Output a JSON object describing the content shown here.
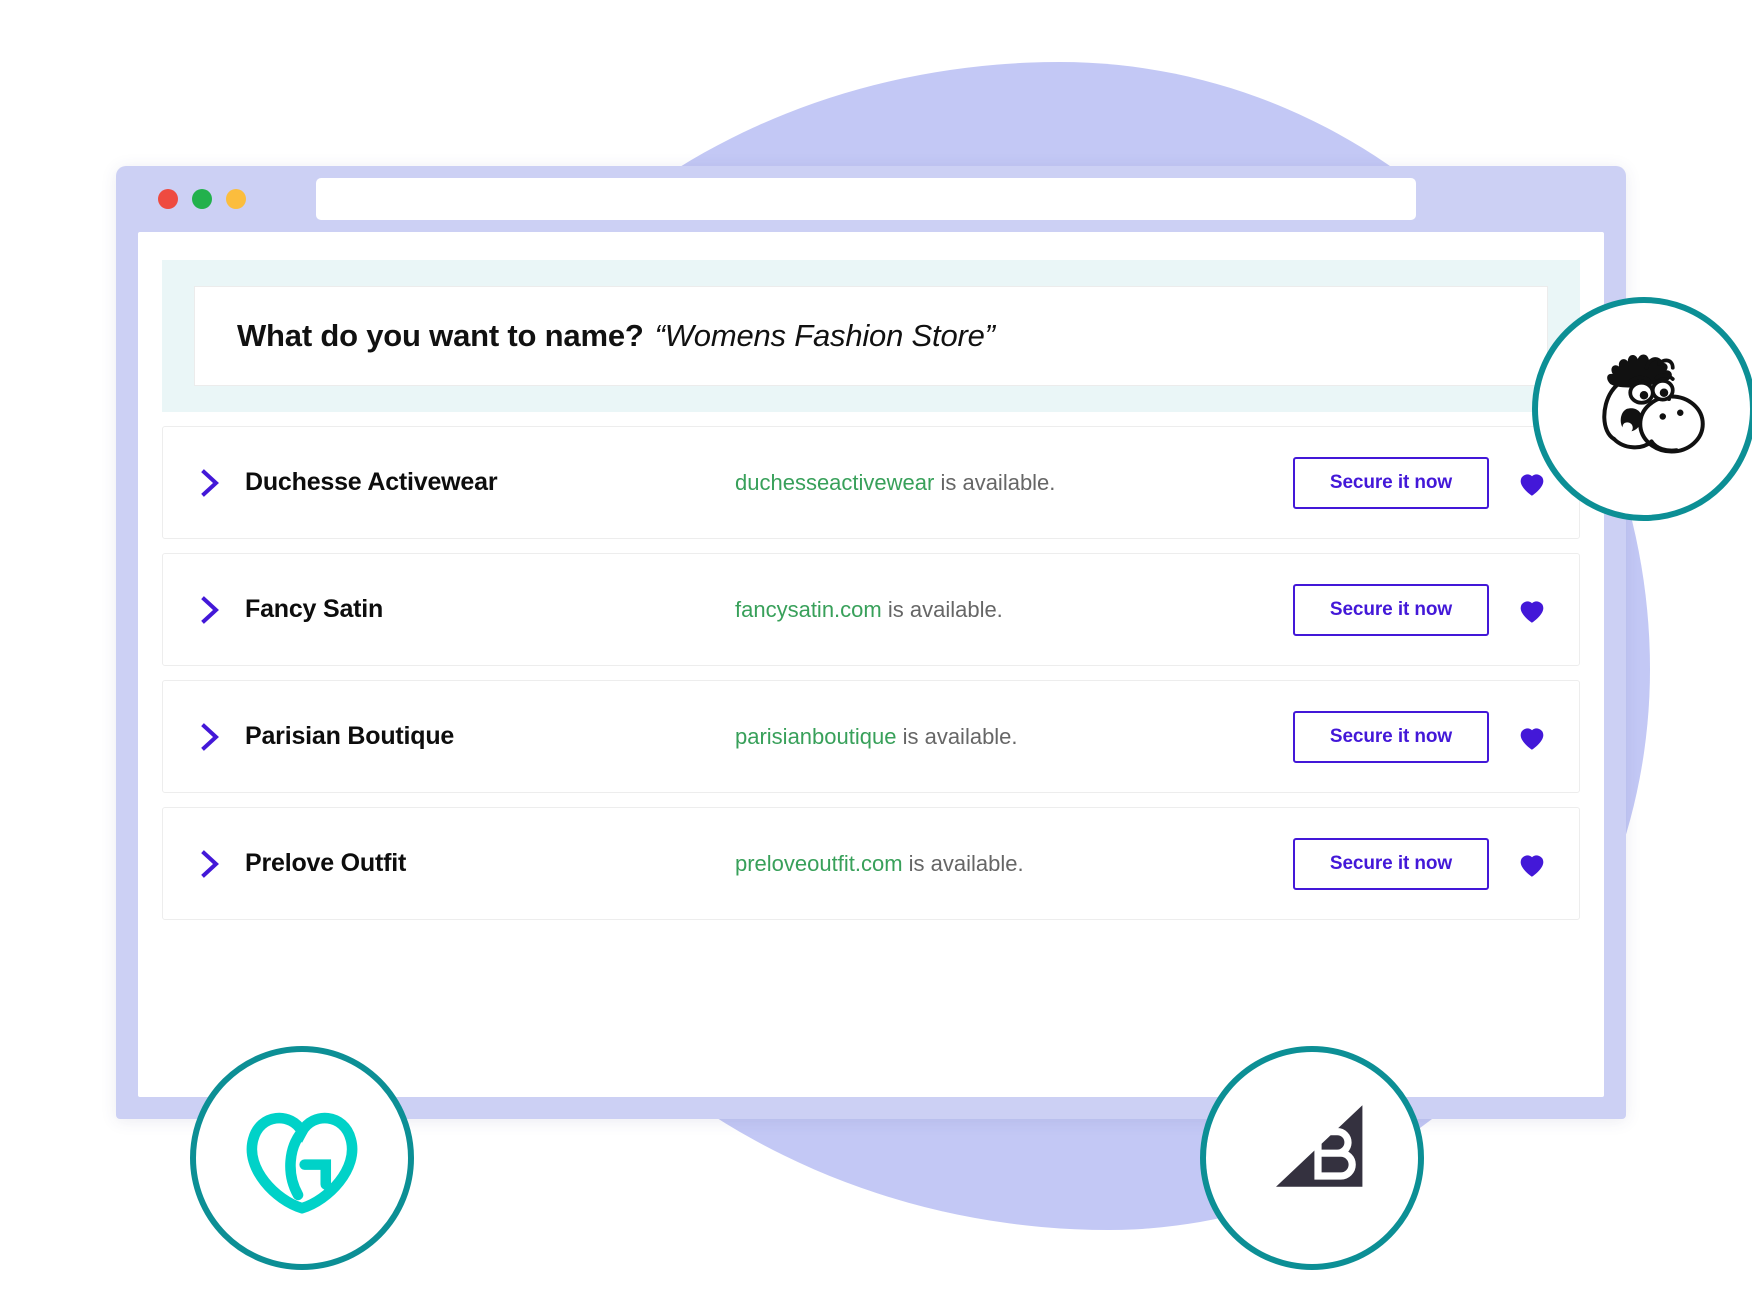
{
  "browser": {
    "traffic_lights": [
      {
        "name": "close-dot",
        "color": "#ee4b40"
      },
      {
        "name": "minimize-dot",
        "color": "#22b14c"
      },
      {
        "name": "maximize-dot",
        "color": "#fbbd3d"
      }
    ],
    "url_value": "",
    "url_placeholder": ""
  },
  "query": {
    "question": "What do you want to name?",
    "term": "“Womens Fashion Store”"
  },
  "results": [
    {
      "name": "Duchesse Activewear",
      "domain": "duchesseactivewear",
      "availability_suffix": " is available.",
      "cta": "Secure it now",
      "favorite_icon": "heart-icon",
      "expand_icon": "chevron-right-icon"
    },
    {
      "name": "Fancy Satin",
      "domain": "fancysatin.com",
      "availability_suffix": " is available.",
      "cta": "Secure it now",
      "favorite_icon": "heart-icon",
      "expand_icon": "chevron-right-icon"
    },
    {
      "name": "Parisian Boutique",
      "domain": "parisianboutique",
      "availability_suffix": " is available.",
      "cta": "Secure it now",
      "favorite_icon": "heart-icon",
      "expand_icon": "chevron-right-icon"
    },
    {
      "name": "Prelove Outfit",
      "domain": "preloveoutfit.com",
      "availability_suffix": " is available.",
      "cta": "Secure it now",
      "favorite_icon": "heart-icon",
      "expand_icon": "chevron-right-icon"
    }
  ],
  "badges": [
    {
      "name": "mascot-badge",
      "icon": "donkey-mascot-icon"
    },
    {
      "name": "godaddy-badge",
      "icon": "godaddy-logo-icon"
    },
    {
      "name": "bigcommerce-badge",
      "icon": "bigcommerce-logo-icon"
    }
  ],
  "colors": {
    "accent_purple": "#4318d8",
    "available_green": "#38a05a",
    "banner_teal": "#eaf6f7",
    "blob_lavender": "#c3c8f5",
    "chrome_lavender": "#ccd0f4",
    "badge_ring_teal": "#0c8f95",
    "godaddy_teal": "#00d2c8",
    "bigcommerce_navy": "#34313f"
  }
}
